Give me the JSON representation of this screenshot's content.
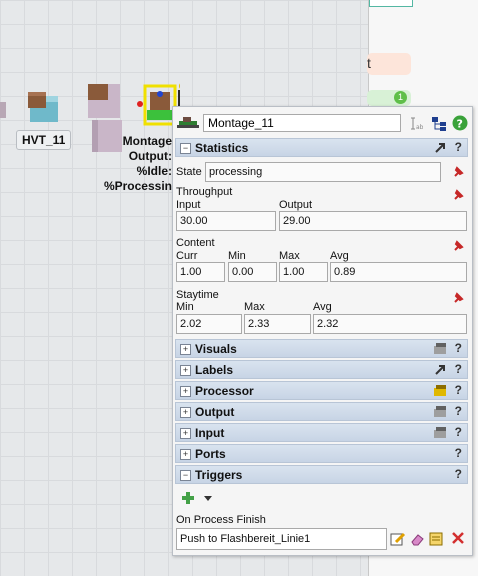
{
  "canvas": {
    "hvt_label": "HVT_11",
    "model_label_lines": [
      "Montage",
      "Output:",
      "%Idle:",
      "%Processin"
    ]
  },
  "right_strip": {
    "peach_text": "t",
    "badge": "1"
  },
  "panel": {
    "object_name": "Montage_11",
    "statistics": {
      "title": "Statistics",
      "state_label": "State",
      "state_value": "processing",
      "throughput": {
        "title": "Throughput",
        "input_label": "Input",
        "output_label": "Output",
        "input_value": "30.00",
        "output_value": "29.00"
      },
      "content": {
        "title": "Content",
        "curr_label": "Curr",
        "min_label": "Min",
        "max_label": "Max",
        "avg_label": "Avg",
        "curr": "1.00",
        "min": "0.00",
        "max": "1.00",
        "avg": "0.89"
      },
      "staytime": {
        "title": "Staytime",
        "min_label": "Min",
        "max_label": "Max",
        "avg_label": "Avg",
        "min": "2.02",
        "max": "2.33",
        "avg": "2.32"
      }
    },
    "sections": {
      "visuals": "Visuals",
      "labels": "Labels",
      "processor": "Processor",
      "output": "Output",
      "input": "Input",
      "ports": "Ports",
      "triggers": "Triggers"
    },
    "triggers": {
      "event_label": "On Process Finish",
      "event_value": "Push to Flashbereit_Linie1"
    },
    "help": "?",
    "collapse": "−",
    "expand": "+"
  }
}
